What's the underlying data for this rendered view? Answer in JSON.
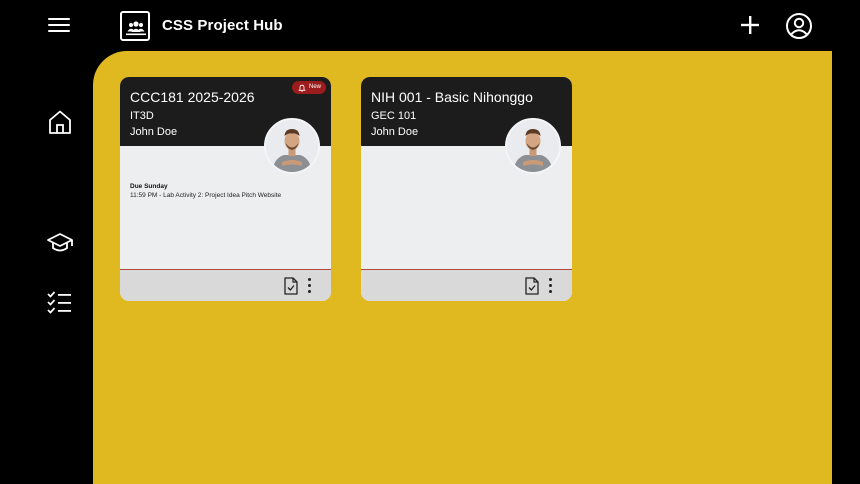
{
  "header": {
    "app_title": "CSS Project Hub",
    "icons": {
      "menu": "hamburger-menu-icon",
      "logo": "classroom-people-icon",
      "add": "plus-icon",
      "account": "account-circle-icon"
    }
  },
  "sidebar": {
    "items": [
      {
        "icon": "home-icon"
      },
      {
        "icon": "graduation-cap-icon"
      },
      {
        "icon": "checklist-icon"
      }
    ]
  },
  "colors": {
    "background": "#000000",
    "panel": "#e0b820",
    "card_header": "#1c1c1c",
    "card_body": "#eceef0",
    "card_footer": "#d9d9da",
    "badge": "#9b1c1c"
  },
  "classes": [
    {
      "title": "CCC181 2025-2026",
      "section": "IT3D",
      "teacher": "John Doe",
      "badge": "New",
      "due_label": "Due Sunday",
      "due_detail": "11:59 PM - Lab Activity 2: Project Idea Pitch Website"
    },
    {
      "title": "NIH 001 - Basic Nihonggo",
      "section": "GEC 101",
      "teacher": "John Doe"
    }
  ]
}
